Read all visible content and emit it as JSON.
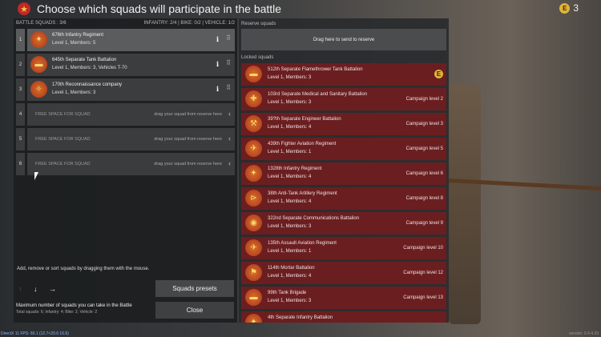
{
  "header": {
    "title": "Choose which squads will participate in the battle",
    "currency_count": "3",
    "coin_glyph": "E"
  },
  "battle": {
    "heading": "BATTLE SQUADS : 3/6",
    "stats": "INFANTRY: 2/4 | BIKE: 0/2 | VEHICLE: 1/2",
    "squads": [
      {
        "num": "1",
        "name": "676th Infantry Regiment",
        "info": "Level 1, Members: 5"
      },
      {
        "num": "2",
        "name": "645th Separate Tank Battalion",
        "info": "Level 1, Members: 3, Vehicles T-70"
      },
      {
        "num": "3",
        "name": "170th Reconnaissance company",
        "info": "Level 1, Members: 3"
      }
    ],
    "empty_slots": [
      {
        "num": "4",
        "label": "FREE SPACE FOR SQUAD",
        "hint": "drag your squad from reserve here"
      },
      {
        "num": "5",
        "label": "FREE SPACE FOR SQUAD",
        "hint": "drag your squad from reserve here"
      },
      {
        "num": "6",
        "label": "FREE SPACE FOR SQUAD",
        "hint": "drag your squad from reserve here"
      }
    ],
    "help": "Add, remove or sort squads by dragging them with the mouse.",
    "presets_label": "Squads presets",
    "close_label": "Close",
    "max_text": "Maximum number of squads you can take in the Battle",
    "max_sub": "Total squads: 6; Infantry: 4; Bike: 2; Vehicle: 2"
  },
  "reserve": {
    "heading": "Reserve squads",
    "drop_hint": "Drag here to send to reserve",
    "locked_heading": "Locked squads",
    "locked": [
      {
        "name": "512th Separate Flamethrower Tank Battalion",
        "info": "Level 1, Members: 3",
        "campaign": ""
      },
      {
        "name": "103rd Separate Medical and Sanitary Battalion",
        "info": "Level 1, Members: 3",
        "campaign": "Campaign level 2"
      },
      {
        "name": "39?th Separate Engineer Battalion",
        "info": "Level 1, Members: 4",
        "campaign": "Campaign level 3"
      },
      {
        "name": "439th Fighter Aviation Regiment",
        "info": "Level 1, Members: 1",
        "campaign": "Campaign level 5"
      },
      {
        "name": "1328th Infantry Regiment",
        "info": "Level 1, Members: 4",
        "campaign": "Campaign level 6"
      },
      {
        "name": "38th Anti-Tank Artillery Regiment",
        "info": "Level 1, Members: 4",
        "campaign": "Campaign level 8"
      },
      {
        "name": "322nd Separate Communications Battalion",
        "info": "Level 1, Members: 3",
        "campaign": "Campaign level 9"
      },
      {
        "name": "135th Assault Aviation Regiment",
        "info": "Level 1, Members: 1",
        "campaign": "Campaign level 10"
      },
      {
        "name": "114th Mortar Battalion",
        "info": "Level 1, Members: 4",
        "campaign": "Campaign level 12"
      },
      {
        "name": "99th Tank Brigade",
        "info": "Level 1, Members: 3",
        "campaign": "Campaign level 13"
      },
      {
        "name": "4th Separate Infantry Battalion",
        "info": "",
        "campaign": ""
      }
    ]
  },
  "footer": {
    "fps": "DirectX 11 FPS: 60.1 (12.7<20.6 16.6)",
    "version": "version: 0.4.4.33"
  },
  "colors": {
    "accent_red": "#6b1e20",
    "coin_gold": "#e0b33a"
  }
}
